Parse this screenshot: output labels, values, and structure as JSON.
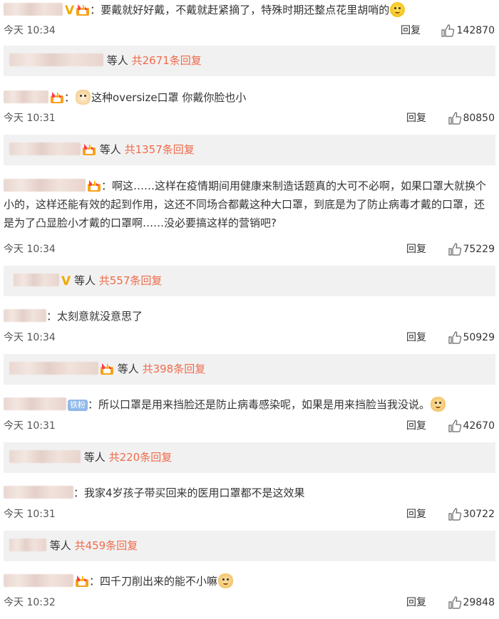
{
  "comments": [
    {
      "text": "要戴就好好戴，不戴就赶紧摘了，特殊时期还整点花里胡哨的",
      "time": "今天 10:34",
      "reply_label": "回复",
      "likes": "142870",
      "thread": {
        "who": "等人",
        "count": "共2671条回复"
      }
    },
    {
      "text": "这种oversize口罩 你戴你脸也小",
      "time": "今天 10:31",
      "reply_label": "回复",
      "likes": "80850",
      "thread": {
        "who": "等人",
        "count": "共1357条回复"
      }
    },
    {
      "text": "啊这……这样在疫情期间用健康来制造话题真的大可不必啊，如果口罩大就换个小的，这样还能有效的起到作用，这还不同场合都戴这种大口罩，到底是为了防止病毒才戴的口罩，还是为了凸显脸小才戴的口罩啊……没必要搞这样的营销吧?",
      "time": "今天 10:34",
      "reply_label": "回复",
      "likes": "75229",
      "thread": {
        "who": "等人",
        "count": "共557条回复"
      }
    },
    {
      "text": "太刻意就没意思了",
      "time": "今天 10:34",
      "reply_label": "回复",
      "likes": "50929",
      "thread": {
        "who": "等人",
        "count": "共398条回复"
      }
    },
    {
      "badge": "铁粉",
      "text": "所以口罩是用来挡脸还是防止病毒感染呢，如果是用来挡脸当我没说。",
      "time": "今天 10:31",
      "reply_label": "回复",
      "likes": "42670",
      "thread": {
        "who": "等人",
        "count": "共220条回复"
      }
    },
    {
      "text": "我家4岁孩子带买回来的医用口罩都不是这效果",
      "time": "今天 10:31",
      "reply_label": "回复",
      "likes": "30722",
      "thread": {
        "who": "等人",
        "count": "共459条回复"
      }
    },
    {
      "text": "四千刀削出来的能不小嘛",
      "time": "今天 10:32",
      "reply_label": "回复",
      "likes": "29848"
    }
  ],
  "colors": {
    "reply_count": "#f06b4b",
    "thread_bg": "#f1f1f1",
    "vip_v": "#f0a900"
  },
  "icons": [
    "thumbs-up-icon",
    "vip-crown-icon",
    "verified-v-icon",
    "emoji-icon"
  ]
}
